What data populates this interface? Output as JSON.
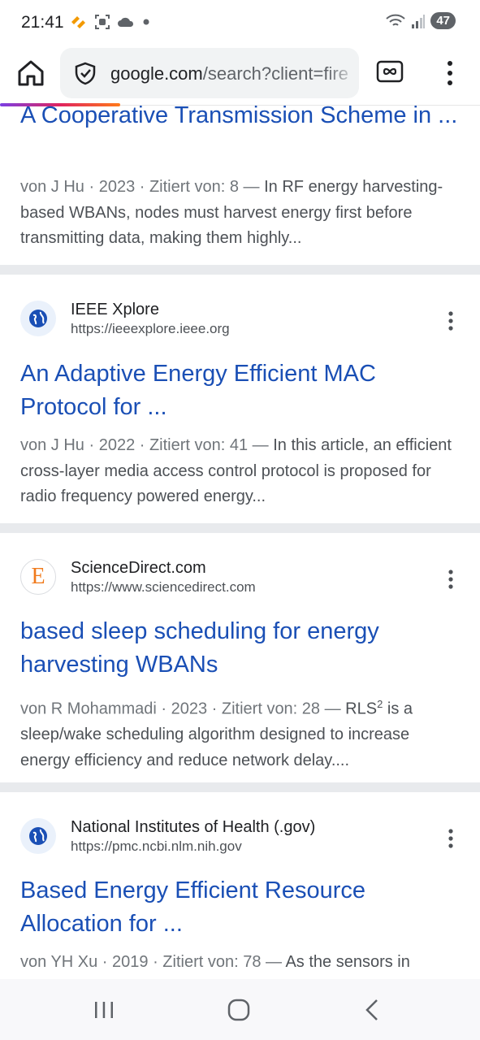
{
  "status": {
    "time": "21:41",
    "battery": "47"
  },
  "browser": {
    "url_domain": "google.com",
    "url_rest": "/search?client=fire",
    "home_icon": "home-icon",
    "tabs_icon": "tabs-infinity-icon",
    "menu_icon": "more-vert-icon"
  },
  "results": [
    {
      "title": "A Cooperative Transmission Scheme in ...",
      "meta": "von J Hu · 2023 · Zitiert von: 8 —",
      "snippet": " In RF energy harvesting-based WBANs, nodes must harvest energy first before transmitting data, making them highly..."
    },
    {
      "source": "IEEE Xplore",
      "url": "https://ieeexplore.ieee.org",
      "title": "An Adaptive Energy Efficient MAC Protocol for ...",
      "meta": "von J Hu · 2022 · Zitiert von: 41 —",
      "snippet": " In this article, an efficient cross-layer media access control protocol is proposed for radio frequency powered energy..."
    },
    {
      "source": "ScienceDirect.com",
      "url": "https://www.sciencedirect.com",
      "favicon_letter": "E",
      "title": "based sleep scheduling for energy harvesting WBANs",
      "meta": "von R Mohammadi · 2023 · Zitiert von: 28 —",
      "snippet_a": " RLS",
      "snippet_sup": "2",
      "snippet_b": " is a sleep/wake scheduling algorithm designed to increase energy efficiency and reduce network delay...."
    },
    {
      "source": "National Institutes of Health (.gov)",
      "url": "https://pmc.ncbi.nlm.nih.gov",
      "title": "Based Energy Efficient Resource Allocation for ...",
      "meta": "von YH Xu · 2019 · Zitiert von: 78 —",
      "snippet": " As the sensors in"
    }
  ],
  "colors": {
    "link": "#1a4fb5",
    "separator": "#e8eaed"
  }
}
